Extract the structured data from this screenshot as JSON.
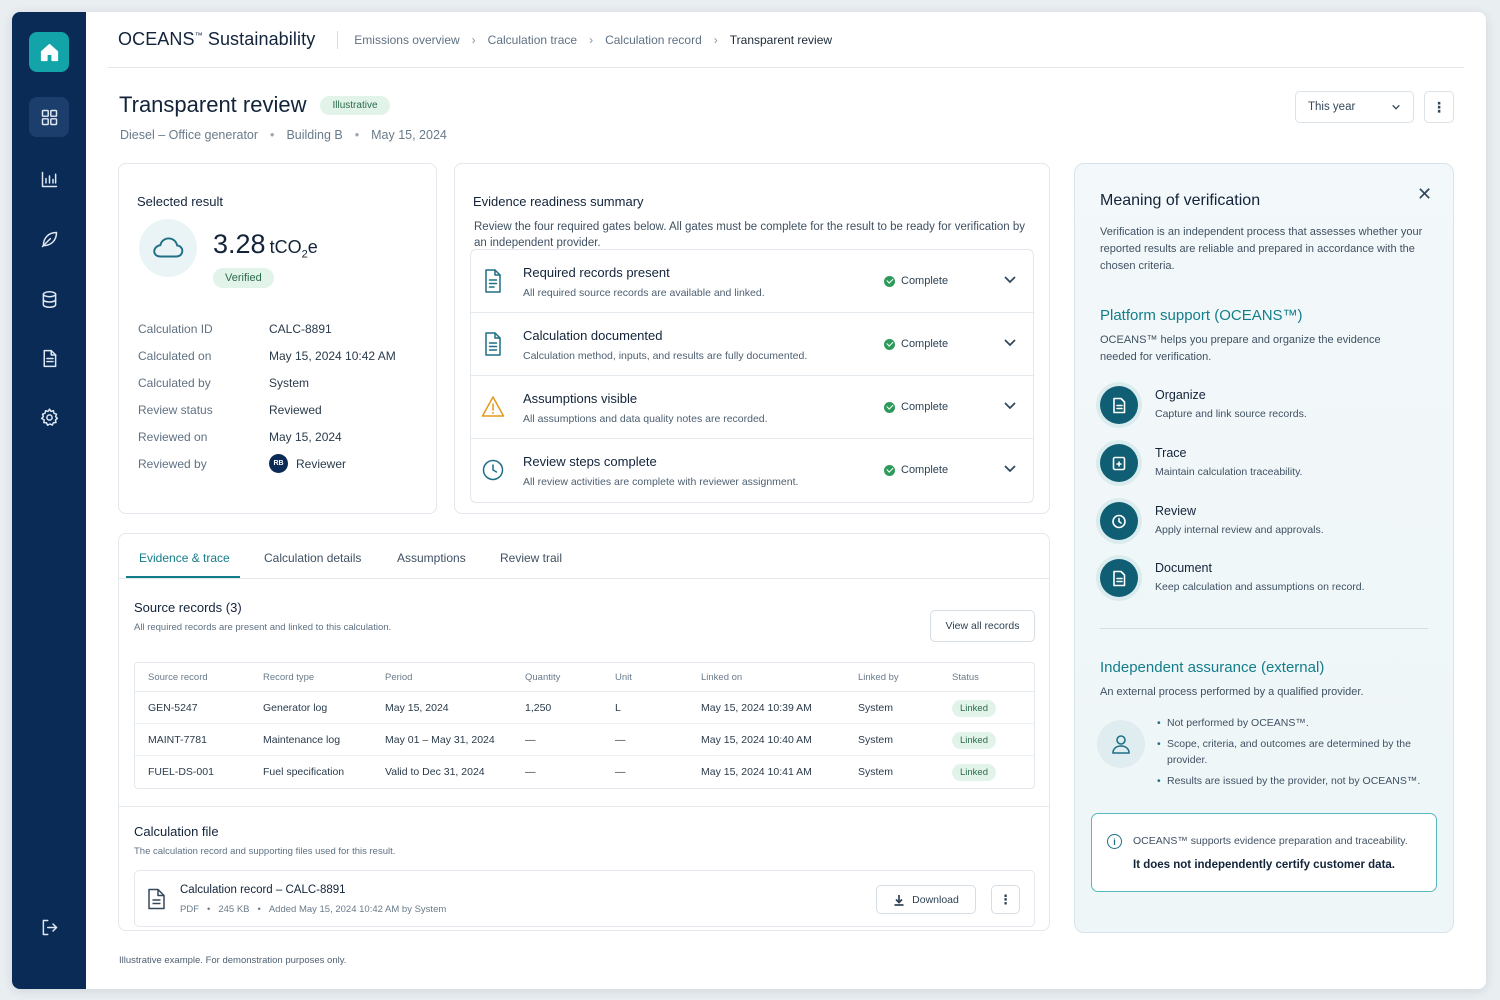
{
  "app": {
    "brand": "OCEANS",
    "brand_mark": "™",
    "brand_suffix": " Sustainability"
  },
  "breadcrumbs": [
    "Emissions overview",
    "Calculation trace",
    "Calculation record",
    "Transparent review"
  ],
  "page": {
    "title": "Transparent review",
    "badge": "Illustrative",
    "meta": [
      "Diesel – Office generator",
      "Building B",
      "May 15, 2024"
    ],
    "period": "This year"
  },
  "selected_result": {
    "heading": "Selected result",
    "value": "3.28",
    "unit": "tCO",
    "unit_sub": "2",
    "unit_tail": "e",
    "status": "Verified",
    "fields": [
      {
        "label": "Calculation ID",
        "value": "CALC-8891"
      },
      {
        "label": "Calculated on",
        "value": "May 15, 2024 10:42 AM"
      },
      {
        "label": "Calculated by",
        "value": "System"
      },
      {
        "label": "Review status",
        "value": "Reviewed"
      },
      {
        "label": "Reviewed on",
        "value": "May 15, 2024"
      },
      {
        "label": "Reviewed by",
        "value": "Reviewer",
        "avatar": "RB"
      }
    ]
  },
  "readiness": {
    "heading": "Evidence readiness summary",
    "description": "Review the four required gates below. All gates must be complete for the result to be ready for verification by an independent provider.",
    "gates": [
      {
        "title": "Required records present",
        "sub": "All required source records are available and linked.",
        "status": "Complete",
        "icon": "document-check-icon"
      },
      {
        "title": "Calculation documented",
        "sub": "Calculation method, inputs, and results are fully documented.",
        "status": "Complete",
        "icon": "document-icon"
      },
      {
        "title": "Assumptions visible",
        "sub": "All assumptions and data quality notes are recorded.",
        "status": "Complete",
        "icon": "warning-icon"
      },
      {
        "title": "Review steps complete",
        "sub": "All review activities are complete with reviewer assignment.",
        "status": "Complete",
        "icon": "clock-icon"
      }
    ]
  },
  "tabs": [
    "Evidence & trace",
    "Calculation details",
    "Assumptions",
    "Review trail"
  ],
  "source_records": {
    "title": "Source records (3)",
    "subtitle": "All required records are present and linked to this calculation.",
    "view_all": "View all records",
    "columns": [
      "Source record",
      "Record type",
      "Period",
      "Quantity",
      "Unit",
      "Linked on",
      "Linked by",
      "Status"
    ],
    "rows": [
      [
        "GEN-5247",
        "Generator log",
        "May 15, 2024",
        "1,250",
        "L",
        "May 15, 2024 10:39 AM",
        "System",
        "Linked"
      ],
      [
        "MAINT-7781",
        "Maintenance log",
        "May 01 – May 31, 2024",
        "—",
        "—",
        "May 15, 2024 10:40 AM",
        "System",
        "Linked"
      ],
      [
        "FUEL-DS-001",
        "Fuel specification",
        "Valid to Dec 31, 2024",
        "—",
        "—",
        "May 15, 2024 10:41 AM",
        "System",
        "Linked"
      ]
    ]
  },
  "calc_file": {
    "title": "Calculation file",
    "subtitle": "The calculation record and supporting files used for this result.",
    "file_name": "Calculation record – CALC-8891",
    "file_type": "PDF",
    "file_size": "245 KB",
    "file_added": "Added May 15, 2024 10:42 AM by System",
    "download": "Download"
  },
  "footnote": "Illustrative example. For demonstration purposes only.",
  "panel": {
    "title": "Meaning of verification",
    "body": "Verification is an independent process that assesses whether your reported results are reliable and prepared in accordance with the chosen criteria.",
    "platform_heading": "Platform support (OCEANS™)",
    "platform_text": "OCEANS™ helps you prepare and organize the evidence needed for verification.",
    "steps": [
      {
        "name": "Organize",
        "desc": "Capture and link source records."
      },
      {
        "name": "Trace",
        "desc": "Maintain calculation traceability."
      },
      {
        "name": "Review",
        "desc": "Apply internal review and approvals."
      },
      {
        "name": "Document",
        "desc": "Keep calculation and assumptions on record."
      }
    ],
    "assurance_heading": "Independent assurance (external)",
    "assurance_text": "An external process performed by a qualified provider.",
    "assurance_points": [
      "Not performed by OCEANS™.",
      "Scope, criteria, and outcomes are determined by the provider.",
      "Results are issued by the provider, not by OCEANS™."
    ],
    "notice_line1": "OCEANS™ supports evidence preparation and traceability.",
    "notice_line2": "It does not independently certify customer data."
  }
}
